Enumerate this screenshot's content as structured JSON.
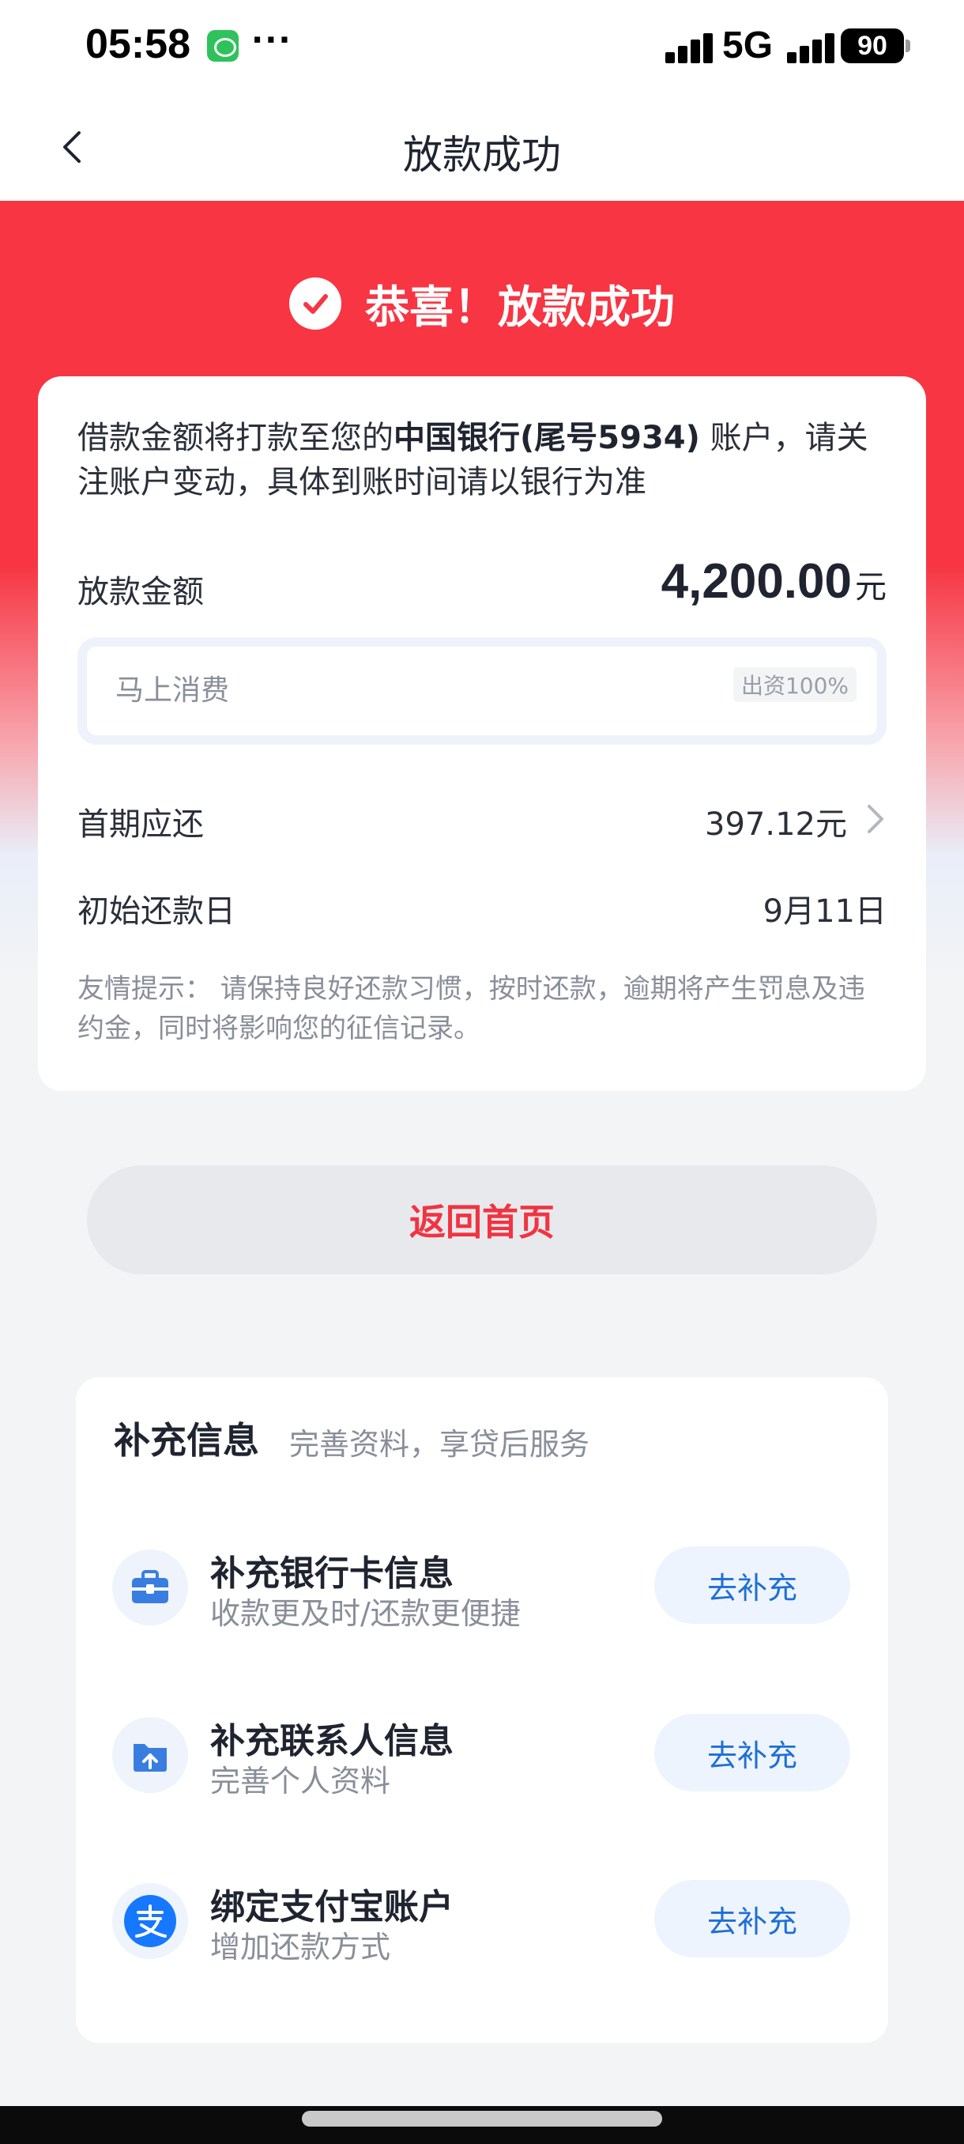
{
  "status_bar": {
    "time": "05:58",
    "dots": "···",
    "network": "5G",
    "battery": "90"
  },
  "nav": {
    "title": "放款成功"
  },
  "hero": {
    "title": "恭喜！放款成功"
  },
  "notice": {
    "prefix": "借款金额将打款至您的",
    "bank": "中国银行(尾号5934)",
    "suffix": " 账户，请关注账户变动，具体到账时间请以银行为准"
  },
  "loan": {
    "amount_label": "放款金额",
    "amount_value": "4,200.00",
    "amount_unit": "元",
    "lender_name": "马上消费",
    "lender_badge": "出资100%",
    "first_payment_label": "首期应还",
    "first_payment_value": "397.12元",
    "start_date_label": "初始还款日",
    "start_date_value": "9月11日",
    "tip": "友情提示： 请保持良好还款习惯，按时还款，逾期将产生罚息及违约金，同时将影响您的征信记录。"
  },
  "actions": {
    "home_button": "返回首页"
  },
  "extra": {
    "title": "补充信息",
    "subtitle": "完善资料，享贷后服务",
    "items": [
      {
        "icon": "toolbox-icon",
        "title": "补充银行卡信息",
        "desc": "收款更及时/还款更便捷",
        "button": "去补充"
      },
      {
        "icon": "upload-folder-icon",
        "title": "补充联系人信息",
        "desc": "完善个人资料",
        "button": "去补充"
      },
      {
        "icon": "alipay-icon",
        "title": "绑定支付宝账户",
        "desc": "增加还款方式",
        "button": "去补充"
      }
    ]
  },
  "colors": {
    "accent_red": "#f73543",
    "primary_blue": "#1f6fd6",
    "button_text_red": "#f03442"
  }
}
